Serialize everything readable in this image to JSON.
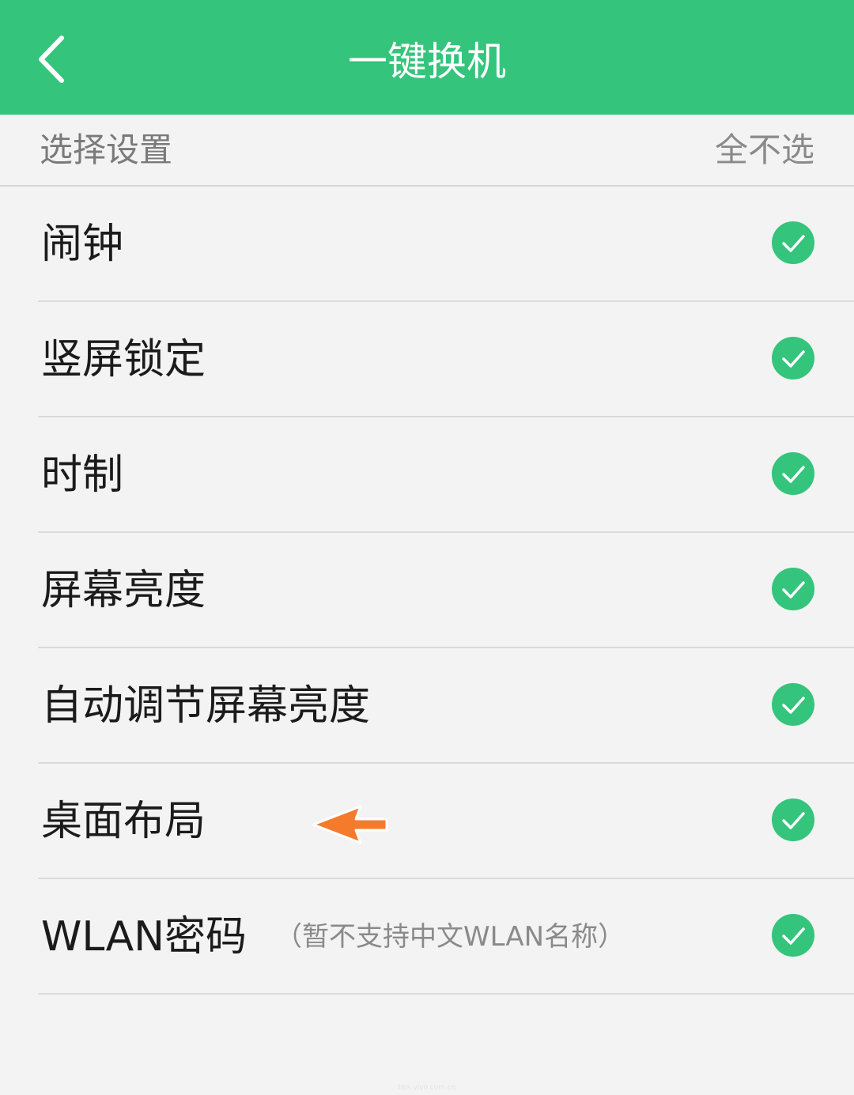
{
  "header": {
    "title": "一键换机",
    "back_icon": "chevron-left-icon",
    "background": "#34c47c"
  },
  "section": {
    "label": "选择设置",
    "action": "全不选"
  },
  "items": [
    {
      "label": "闹钟",
      "note": "",
      "checked": true
    },
    {
      "label": "竖屏锁定",
      "note": "",
      "checked": true
    },
    {
      "label": "时制",
      "note": "",
      "checked": true
    },
    {
      "label": "屏幕亮度",
      "note": "",
      "checked": true
    },
    {
      "label": "自动调节屏幕亮度",
      "note": "",
      "checked": true
    },
    {
      "label": "桌面布局",
      "note": "",
      "checked": true
    },
    {
      "label": "WLAN密码",
      "note": "（暂不支持中文WLAN名称）",
      "checked": true
    }
  ],
  "colors": {
    "accent": "#34c47c",
    "annotation_arrow": "#f47a2c"
  },
  "watermark": "bbs.vivo.com.cn"
}
